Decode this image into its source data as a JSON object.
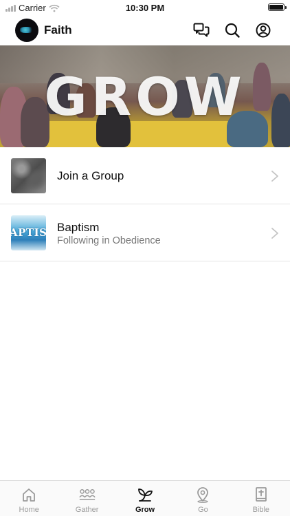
{
  "status_bar": {
    "carrier": "Carrier",
    "time": "10:30 PM"
  },
  "header": {
    "title": "Faith",
    "icons": [
      "chat-bubbles-icon",
      "search-icon",
      "profile-icon"
    ]
  },
  "hero": {
    "text": "GROW"
  },
  "list": {
    "items": [
      {
        "title": "Join a Group",
        "subtitle": "",
        "thumbnail": "group-thumbnail"
      },
      {
        "title": "Baptism",
        "subtitle": "Following in Obedience",
        "thumbnail": "baptism-thumbnail",
        "thumb_text": "APTIS"
      }
    ]
  },
  "tabbar": {
    "active": "Grow",
    "tabs": [
      {
        "label": "Home",
        "icon": "home-icon"
      },
      {
        "label": "Gather",
        "icon": "people-icon"
      },
      {
        "label": "Grow",
        "icon": "sprout-icon"
      },
      {
        "label": "Go",
        "icon": "location-pin-icon"
      },
      {
        "label": "Bible",
        "icon": "bible-icon"
      }
    ]
  },
  "colors": {
    "active_tab": "#111111",
    "inactive_tab": "#9a9a9a",
    "divider": "#e4e4e4"
  }
}
